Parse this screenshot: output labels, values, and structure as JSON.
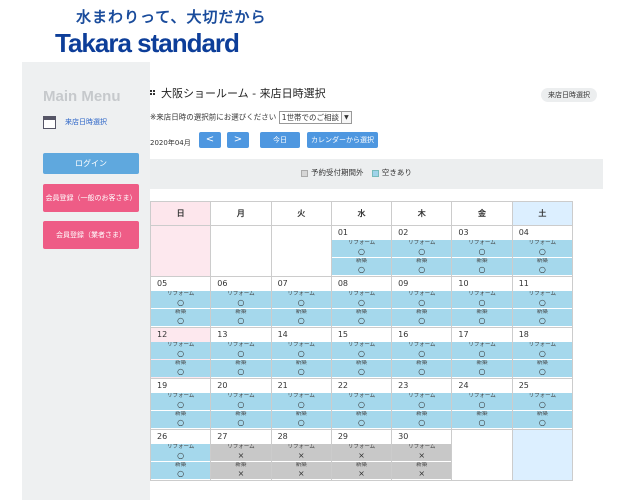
{
  "header": {
    "tagline": "水まわりって、大切だから",
    "logo": "Takara standard",
    "brand_color": "#0d3e99"
  },
  "sidebar": {
    "title": "Main Menu",
    "link": "来店日時選択",
    "login": "ログイン",
    "register_general": "会員登録（一般のお客さま）",
    "register_business": "会員登録（業者さま）"
  },
  "main": {
    "title": "大阪ショールーム - 来店日時選択",
    "badge": "来店日時選択",
    "notice": "※来店日時の選択前にお選びください",
    "party_select": "1世帯でのご相談",
    "month": "2020年04月",
    "prev": "<",
    "next": ">",
    "today": "今日",
    "from_calendar": "カレンダーから選択"
  },
  "legend": {
    "closed": "予約受付期間外",
    "available": "空きあり"
  },
  "calendar": {
    "weekdays": [
      "日",
      "月",
      "火",
      "水",
      "木",
      "金",
      "土"
    ],
    "slot_labels": [
      "リフォーム",
      "新築"
    ],
    "ok_mark": "○",
    "ng_mark": "×",
    "weeks": [
      [
        {
          "d": ""
        },
        {
          "d": ""
        },
        {
          "d": ""
        },
        {
          "d": "01",
          "s": "ok"
        },
        {
          "d": "02",
          "s": "ok"
        },
        {
          "d": "03",
          "s": "ok"
        },
        {
          "d": "04",
          "s": "ok"
        }
      ],
      [
        {
          "d": "05",
          "s": "ok"
        },
        {
          "d": "06",
          "s": "ok"
        },
        {
          "d": "07",
          "s": "ok"
        },
        {
          "d": "08",
          "s": "ok"
        },
        {
          "d": "09",
          "s": "ok"
        },
        {
          "d": "10",
          "s": "ok"
        },
        {
          "d": "11",
          "s": "ok"
        }
      ],
      [
        {
          "d": "12",
          "s": "ok"
        },
        {
          "d": "13",
          "s": "ok"
        },
        {
          "d": "14",
          "s": "ok"
        },
        {
          "d": "15",
          "s": "ok"
        },
        {
          "d": "16",
          "s": "ok"
        },
        {
          "d": "17",
          "s": "ok"
        },
        {
          "d": "18",
          "s": "ok"
        }
      ],
      [
        {
          "d": "19",
          "s": "ok"
        },
        {
          "d": "20",
          "s": "ok"
        },
        {
          "d": "21",
          "s": "ok"
        },
        {
          "d": "22",
          "s": "ok"
        },
        {
          "d": "23",
          "s": "ok"
        },
        {
          "d": "24",
          "s": "ok"
        },
        {
          "d": "25",
          "s": "ok"
        }
      ],
      [
        {
          "d": "26",
          "s": "ok"
        },
        {
          "d": "27",
          "s": "ng"
        },
        {
          "d": "28",
          "s": "ng"
        },
        {
          "d": "29",
          "s": "ng"
        },
        {
          "d": "30",
          "s": "ng"
        },
        {
          "d": ""
        },
        {
          "d": ""
        }
      ]
    ]
  }
}
